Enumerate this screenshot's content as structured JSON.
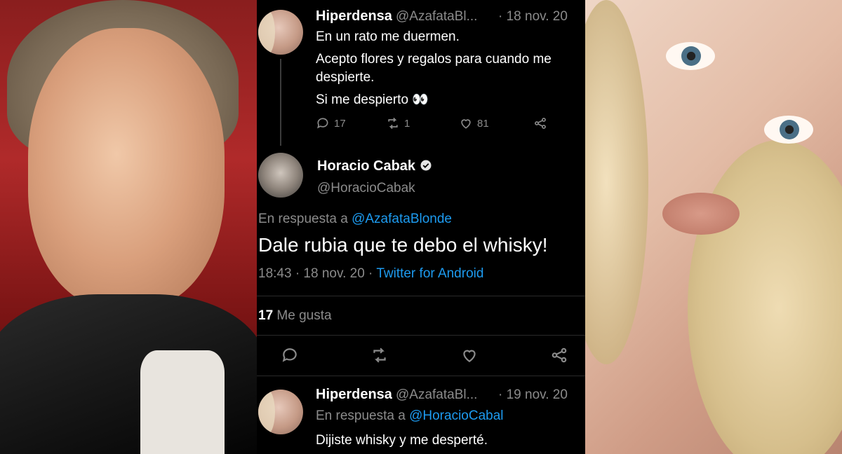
{
  "tweet1": {
    "name": "Hiperdensa",
    "handle": "@AzafataBl...",
    "date": "· 18 nov. 20",
    "lines": [
      "En un rato me duermen.",
      "Acepto flores y regalos para cuando me",
      "despierte.",
      "Si me despierto 👀"
    ],
    "replies": "17",
    "retweets": "1",
    "likes": "81"
  },
  "tweet2": {
    "name": "Horacio Cabak",
    "handle": "@HoracioCabak",
    "reply_prefix": "En respuesta a",
    "reply_handle": "@AzafataBlonde",
    "text": "Dale rubia que te debo el whisky!",
    "time": "18:43 · 18 nov. 20 ·",
    "client": "Twitter for Android",
    "likes_count": "17",
    "likes_label": "Me gusta"
  },
  "tweet3": {
    "name": "Hiperdensa",
    "handle": "@AzafataBl...",
    "date": "· 19 nov. 20",
    "reply_prefix": "En respuesta a",
    "reply_handle": "@HoracioCabal",
    "text": "Dijiste whisky y me desperté."
  },
  "colors": {
    "background": "#000000",
    "text": "#ffffff",
    "muted": "#8b8b8b",
    "link": "#1d9bf0"
  }
}
